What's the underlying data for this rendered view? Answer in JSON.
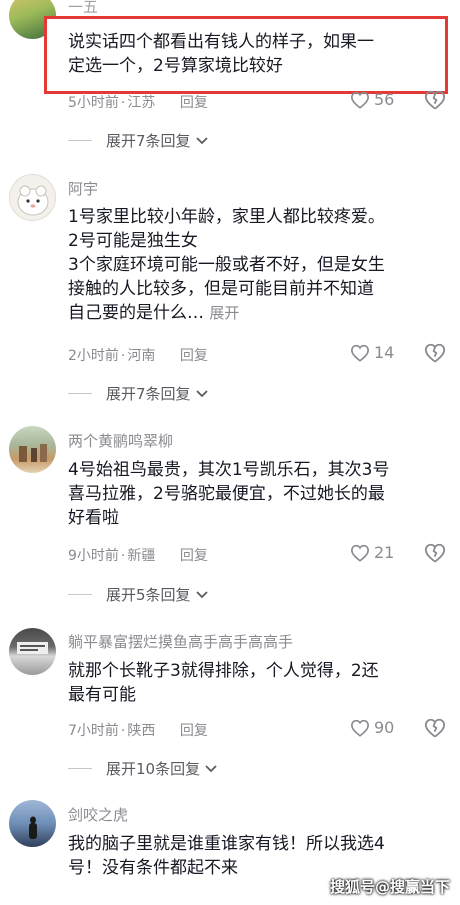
{
  "comments": [
    {
      "username": "一五",
      "lines": [
        "说实话四个都看出有钱人的样子，如果一",
        "定选一个，2号算家境比较好"
      ],
      "time": "5小时前",
      "location": "江苏",
      "reply_label": "回复",
      "likes": "56",
      "replies_label": "展开7条回复"
    },
    {
      "username": "阿宇",
      "lines": [
        "1号家里比较小年龄，家里人都比较疼爱。",
        "2号可能是独生女",
        "3个家庭环境可能一般或者不好，但是女生",
        "接触的人比较多，但是可能目前并不知道",
        "自己要的是什么…"
      ],
      "expand_label": "展开",
      "time": "2小时前",
      "location": "河南",
      "reply_label": "回复",
      "likes": "14",
      "replies_label": "展开7条回复"
    },
    {
      "username": "两个黄鹂鸣翠柳",
      "lines": [
        "4号始祖鸟最贵，其次1号凯乐石，其次3号",
        "喜马拉雅，2号骆驼最便宜，不过她长的最",
        "好看啦"
      ],
      "time": "9小时前",
      "location": "新疆",
      "reply_label": "回复",
      "likes": "21",
      "replies_label": "展开5条回复"
    },
    {
      "username": "躺平暴富摆烂摸鱼高手高手高高手",
      "lines": [
        "就那个长靴子3就得排除，个人觉得，2还",
        "最有可能"
      ],
      "time": "7小时前",
      "location": "陕西",
      "reply_label": "回复",
      "likes": "90",
      "replies_label": "展开10条回复"
    },
    {
      "username": "剑咬之虎",
      "lines": [
        "我的脑子里就是谁重谁家有钱！所以我选4",
        "号！没有条件都起不来"
      ]
    }
  ],
  "watermark": "搜狐号@搜赢当下",
  "colors": {
    "highlight": "#e53935",
    "meta": "#8a8b91",
    "text": "#161823"
  },
  "icons": {
    "like": "heart-outline-icon",
    "dislike": "broken-heart-icon",
    "expand": "chevron-down-icon"
  }
}
